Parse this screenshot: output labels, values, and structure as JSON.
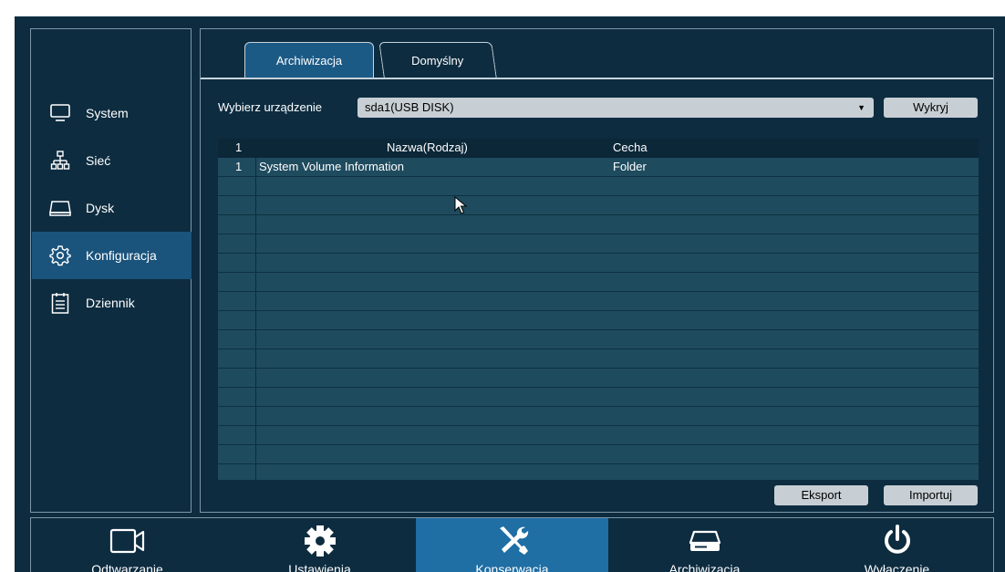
{
  "sidebar": {
    "items": [
      {
        "label": "System",
        "icon": "monitor-icon"
      },
      {
        "label": "Sieć",
        "icon": "network-icon"
      },
      {
        "label": "Dysk",
        "icon": "disk-icon"
      },
      {
        "label": "Konfiguracja",
        "icon": "settings-gear-icon",
        "active": true
      },
      {
        "label": "Dziennik",
        "icon": "log-clipboard-icon"
      }
    ]
  },
  "tabs": [
    {
      "label": "Archiwizacja",
      "active": true
    },
    {
      "label": "Domyślny",
      "active": false
    }
  ],
  "device": {
    "label": "Wybierz urządzenie",
    "selected": "sda1(USB DISK)",
    "detect_button": "Wykryj"
  },
  "table": {
    "header": {
      "num": "1",
      "name": "Nazwa(Rodzaj)",
      "type": "Cecha"
    },
    "rows": [
      {
        "num": "1",
        "name": "System Volume Information",
        "type": "Folder"
      },
      {
        "num": "",
        "name": "",
        "type": ""
      },
      {
        "num": "",
        "name": "",
        "type": ""
      },
      {
        "num": "",
        "name": "",
        "type": ""
      },
      {
        "num": "",
        "name": "",
        "type": ""
      },
      {
        "num": "",
        "name": "",
        "type": ""
      },
      {
        "num": "",
        "name": "",
        "type": ""
      },
      {
        "num": "",
        "name": "",
        "type": ""
      },
      {
        "num": "",
        "name": "",
        "type": ""
      },
      {
        "num": "",
        "name": "",
        "type": ""
      },
      {
        "num": "",
        "name": "",
        "type": ""
      },
      {
        "num": "",
        "name": "",
        "type": ""
      },
      {
        "num": "",
        "name": "",
        "type": ""
      },
      {
        "num": "",
        "name": "",
        "type": ""
      },
      {
        "num": "",
        "name": "",
        "type": ""
      },
      {
        "num": "",
        "name": "",
        "type": ""
      },
      {
        "num": "",
        "name": "",
        "type": ""
      }
    ]
  },
  "actions": {
    "export": "Eksport",
    "import": "Importuj"
  },
  "footer": {
    "items": [
      {
        "label": "Odtwarzanie",
        "icon": "playback-camera-icon"
      },
      {
        "label": "Ustawienia",
        "icon": "settings-gear-icon"
      },
      {
        "label": "Konserwacja",
        "icon": "maintenance-tools-icon",
        "active": true
      },
      {
        "label": "Archiwizacja",
        "icon": "archive-drive-icon"
      },
      {
        "label": "Wyłączenie",
        "icon": "power-icon"
      }
    ]
  },
  "colors": {
    "background": "#0d2c40",
    "active": "#1a537c",
    "footer_active": "#1f6ea4",
    "row": "#1f4b5e"
  }
}
